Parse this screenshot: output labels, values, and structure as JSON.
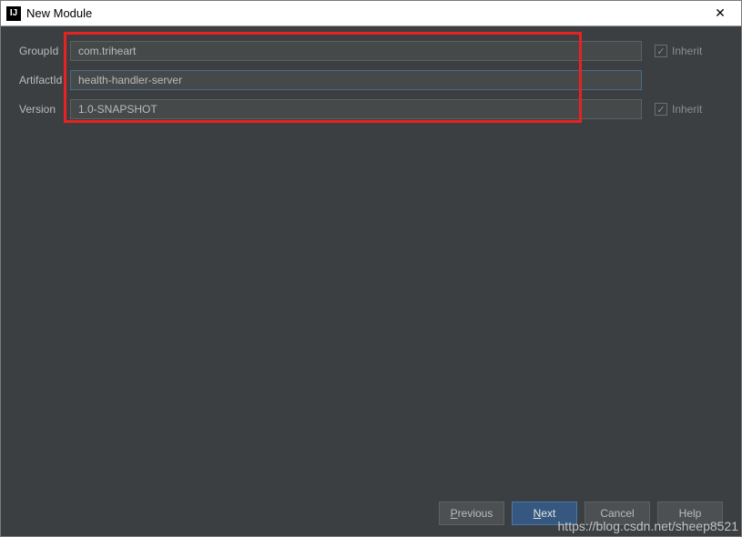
{
  "window": {
    "title": "New Module",
    "icon_glyph": "IJ"
  },
  "form": {
    "groupId": {
      "label": "GroupId",
      "value": "com.triheart",
      "inherit_label": "Inherit",
      "inherit_checked": true,
      "show_inherit": true
    },
    "artifactId": {
      "label": "ArtifactId",
      "value": "health-handler-server",
      "show_inherit": false
    },
    "version": {
      "label": "Version",
      "value": "1.0-SNAPSHOT",
      "inherit_label": "Inherit",
      "inherit_checked": true,
      "show_inherit": true
    }
  },
  "buttons": {
    "previous": "Previous",
    "next": "Next",
    "cancel": "Cancel",
    "help": "Help"
  },
  "watermark": "https://blog.csdn.net/sheep8521"
}
